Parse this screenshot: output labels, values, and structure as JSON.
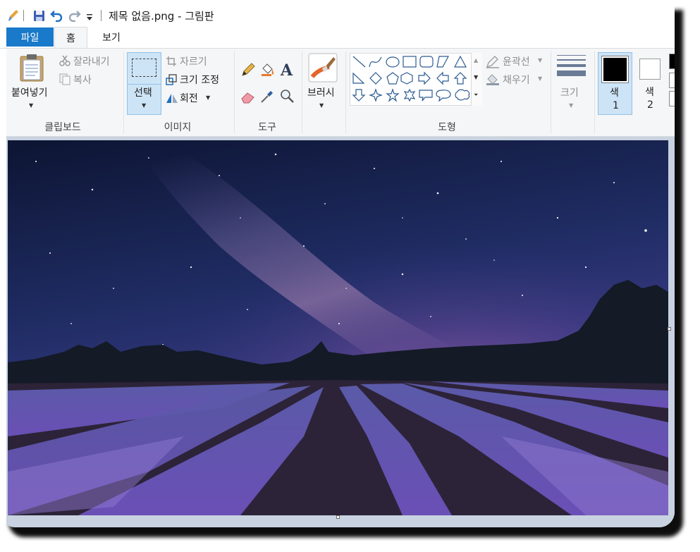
{
  "title_bar": {
    "file_name": "제목 없음.png - 그림판"
  },
  "tabs": [
    {
      "label": "파일",
      "active": false
    },
    {
      "label": "홈",
      "active": true
    },
    {
      "label": "보기",
      "active": false
    }
  ],
  "ribbon": {
    "clipboard": {
      "paste_label": "붙여넣기",
      "cut_label": "잘라내기",
      "copy_label": "복사",
      "group_label": "클립보드"
    },
    "image": {
      "select_label": "선택",
      "crop_label": "자르기",
      "resize_label": "크기 조정",
      "rotate_label": "회전",
      "group_label": "이미지"
    },
    "tools": {
      "group_label": "도구",
      "icons": [
        "pencil-icon",
        "fill-icon",
        "text-icon",
        "eraser-icon",
        "color-picker-icon",
        "magnifier-icon"
      ]
    },
    "brushes": {
      "label": "브러시"
    },
    "shapes": {
      "outline_label": "윤곽선",
      "fill_label": "채우기",
      "group_label": "도형"
    },
    "size": {
      "label": "크기"
    },
    "colors": {
      "color1_label": "색",
      "color1_index": "1",
      "color2_label": "색",
      "color2_index": "2",
      "color1_value": "#000000",
      "color2_value": "#ffffff"
    }
  },
  "colors": {
    "accent": "#1979ca",
    "ribbon_bg": "#f5f6f7",
    "canvas_bg": "#c8d2e0"
  }
}
